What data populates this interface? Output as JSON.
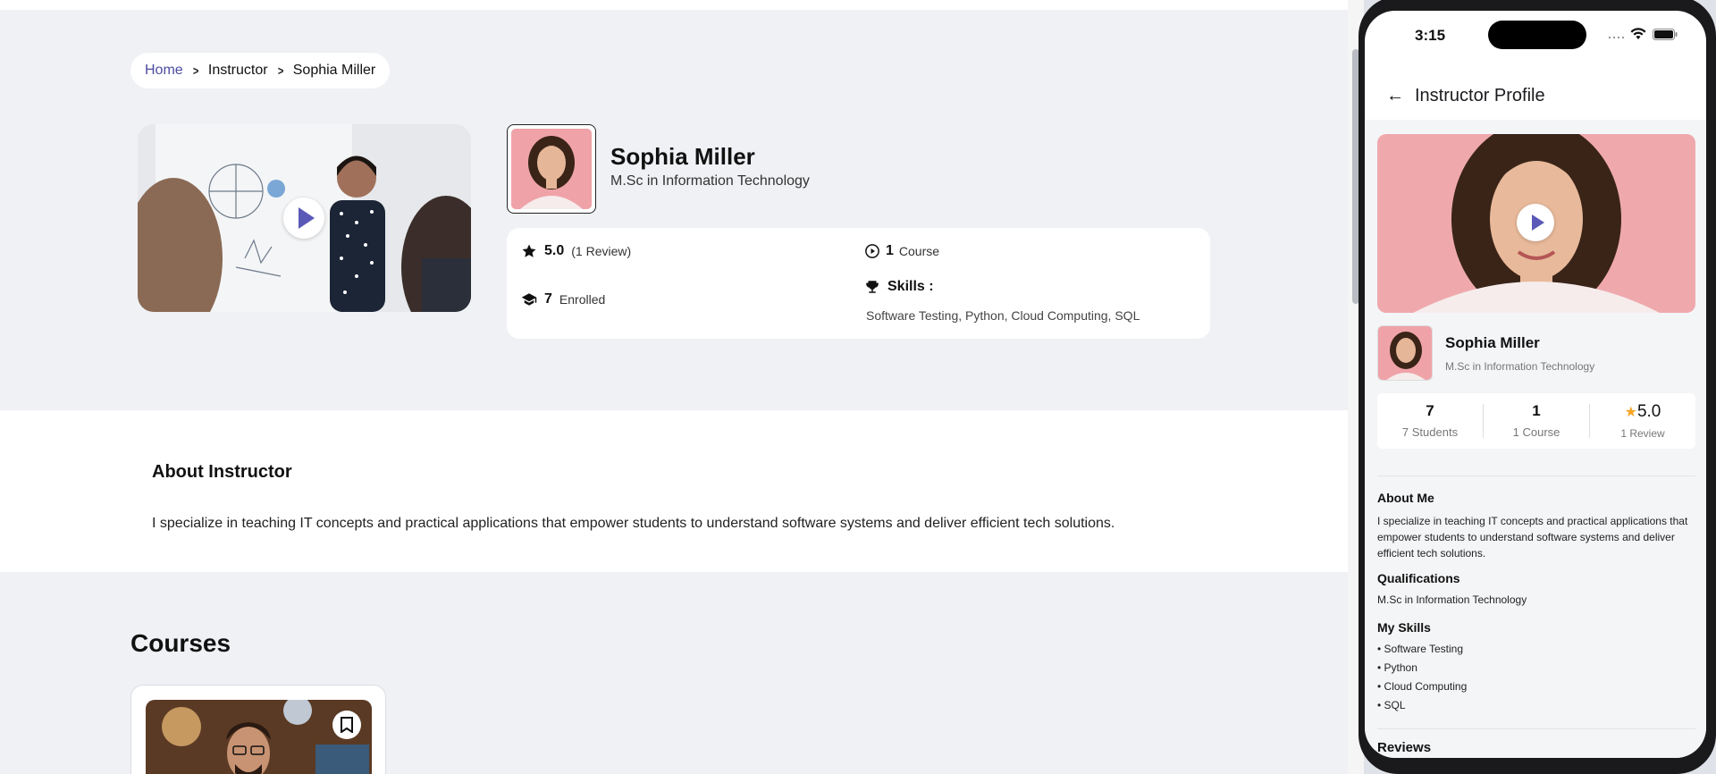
{
  "web": {
    "breadcrumb": {
      "home": "Home",
      "section": "Instructor",
      "current": "Sophia Miller"
    },
    "instructor": {
      "name": "Sophia Miller",
      "degree": "M.Sc in Information Technology"
    },
    "stats": {
      "rating": "5.0",
      "reviews": "(1 Review)",
      "enrolled_count": "7",
      "enrolled_label": "Enrolled",
      "course_count": "1",
      "course_label": "Course",
      "skills_label": "Skills :",
      "skills": "Software Testing, Python, Cloud Computing, SQL"
    },
    "about": {
      "title": "About Instructor",
      "text": "I specialize in teaching IT concepts and practical applications that empower students to understand software systems and deliver efficient tech solutions."
    },
    "courses_title": "Courses"
  },
  "phone": {
    "time": "3:15",
    "header_title": "Instructor Profile",
    "name": "Sophia Miller",
    "degree": "M.Sc in Information Technology",
    "stats": [
      {
        "value": "7",
        "label": "7 Students"
      },
      {
        "value": "1",
        "label": "1 Course"
      },
      {
        "value": "5.0",
        "label": "1 Review"
      }
    ],
    "about_title": "About Me",
    "about_text": "I specialize in teaching IT concepts and practical applications that empower students to understand software systems and deliver efficient tech solutions.",
    "qualifications_title": "Qualifications",
    "qualifications_text": "M.Sc in Information Technology",
    "skills_title": "My Skills",
    "skills": [
      "• Software Testing",
      "• Python",
      "• Cloud Computing",
      "• SQL"
    ],
    "reviews_title": "Reviews"
  },
  "colors": {
    "accent": "#5a59b8",
    "star": "#f5a524",
    "page_bg": "#eff1f4"
  }
}
